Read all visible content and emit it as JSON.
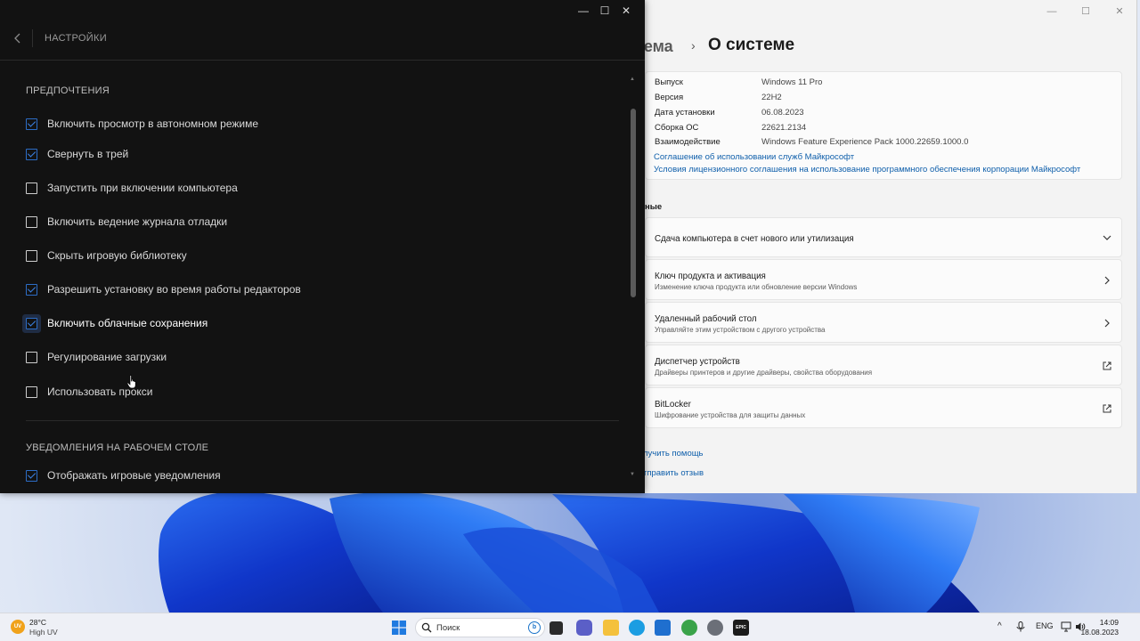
{
  "launcher": {
    "header_title": "НАСТРОЙКИ",
    "window_controls": {
      "minimize": "—",
      "maximize": "☐",
      "close": "✕"
    },
    "sections": {
      "preferences": "ПРЕДПОЧТЕНИЯ",
      "desktop_notifications": "УВЕДОМЛЕНИЯ НА РАБОЧЕМ СТОЛЕ"
    },
    "options": [
      {
        "label": "Включить просмотр в автономном режиме",
        "checked": true
      },
      {
        "label": "Свернуть в трей",
        "checked": true
      },
      {
        "label": "Запустить при включении компьютера",
        "checked": false
      },
      {
        "label": "Включить ведение журнала отладки",
        "checked": false
      },
      {
        "label": "Скрыть игровую библиотеку",
        "checked": false
      },
      {
        "label": "Разрешить установку во время работы редакторов",
        "checked": true
      },
      {
        "label": "Включить облачные сохранения",
        "checked": true
      },
      {
        "label": "Регулирование загрузки",
        "checked": false
      },
      {
        "label": "Использовать прокси",
        "checked": false
      }
    ],
    "notification_options": [
      {
        "label": "Отображать игровые уведомления",
        "checked": true
      }
    ]
  },
  "system_settings": {
    "window_controls": {
      "minimize": "—",
      "maximize": "☐",
      "close": "✕"
    },
    "breadcrumb_parent": "тема",
    "breadcrumb_separator": "›",
    "breadcrumb_current": "О системе",
    "specs": [
      {
        "key": "Выпуск",
        "value": "Windows 11 Pro"
      },
      {
        "key": "Версия",
        "value": "22H2"
      },
      {
        "key": "Дата установки",
        "value": "06.08.2023"
      },
      {
        "key": "Сборка ОС",
        "value": "22621.2134"
      },
      {
        "key": "Взаимодействие",
        "value": "Windows Feature Experience Pack 1000.22659.1000.0"
      }
    ],
    "links": [
      "Соглашение об использовании служб Майкрософт",
      "Условия лицензионного соглашения на использование программного обеспечения корпорации Майкрософт"
    ],
    "related_label": "ные",
    "cards": [
      {
        "title": "Сдача компьютера в счет нового или утилизация",
        "subtitle": "",
        "icon": "chevron-down-icon"
      },
      {
        "title": "Ключ продукта и активация",
        "subtitle": "Изменение ключа продукта или обновление версии Windows",
        "icon": "chevron-right-icon"
      },
      {
        "title": "Удаленный рабочий стол",
        "subtitle": "Управляйте этим устройством с другого устройства",
        "icon": "chevron-right-icon"
      },
      {
        "title": "Диспетчер устройств",
        "subtitle": "Драйверы принтеров и другие драйверы, свойства оборудования",
        "icon": "external-link-icon"
      },
      {
        "title": "BitLocker",
        "subtitle": "Шифрование устройства для защиты данных",
        "icon": "external-link-icon"
      }
    ],
    "footer_links": [
      "лучить помощь",
      "тправить отзыв"
    ]
  },
  "taskbar": {
    "weather_badge": "UV",
    "weather_temp": "28°C",
    "weather_condition": "High UV",
    "search_placeholder": "Поиск",
    "search_badge": "b",
    "apps": [
      {
        "name": "task-view-icon",
        "color": "#2b2b2b"
      },
      {
        "name": "chat-icon",
        "color": "#5b5fc7"
      },
      {
        "name": "file-explorer-icon",
        "color": "#f4c13d"
      },
      {
        "name": "edge-icon",
        "color": "#1b9de2"
      },
      {
        "name": "store-icon",
        "color": "#1f6fcf"
      },
      {
        "name": "torrent-icon",
        "color": "#3aa34a"
      },
      {
        "name": "settings-gear-icon",
        "color": "#6b6f78"
      },
      {
        "name": "epic-games-icon",
        "color": "#1b1b1b"
      }
    ],
    "epic_label": "EPIC",
    "language": "ENG",
    "chevron_up": "^",
    "time": "14:09",
    "date": "18.08.2023"
  }
}
